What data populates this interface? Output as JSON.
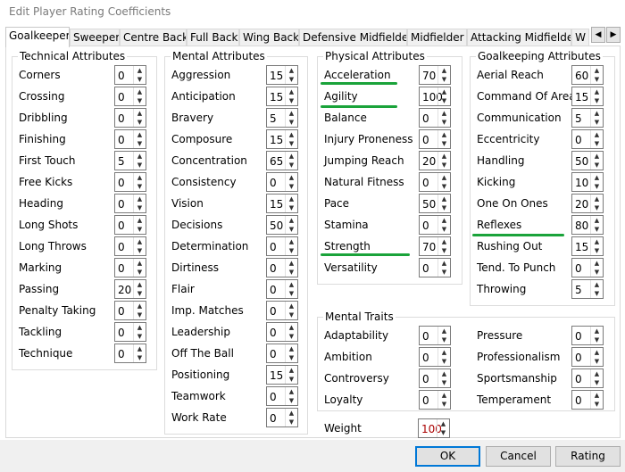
{
  "window": {
    "title": "Edit Player Rating Coefficients"
  },
  "tabs": [
    {
      "label": "Goalkeeper",
      "active": true
    },
    {
      "label": "Sweeper"
    },
    {
      "label": "Centre Back"
    },
    {
      "label": "Full Back"
    },
    {
      "label": "Wing Back"
    },
    {
      "label": "Defensive Midfielder"
    },
    {
      "label": "Midfielder"
    },
    {
      "label": "Attacking Midfielder"
    },
    {
      "label": "W"
    }
  ],
  "technical": {
    "title": "Technical Attributes",
    "items": [
      {
        "label": "Corners",
        "value": "0"
      },
      {
        "label": "Crossing",
        "value": "0"
      },
      {
        "label": "Dribbling",
        "value": "0"
      },
      {
        "label": "Finishing",
        "value": "0"
      },
      {
        "label": "First Touch",
        "value": "5"
      },
      {
        "label": "Free Kicks",
        "value": "0"
      },
      {
        "label": "Heading",
        "value": "0"
      },
      {
        "label": "Long Shots",
        "value": "0"
      },
      {
        "label": "Long Throws",
        "value": "0"
      },
      {
        "label": "Marking",
        "value": "0"
      },
      {
        "label": "Passing",
        "value": "20"
      },
      {
        "label": "Penalty Taking",
        "value": "0"
      },
      {
        "label": "Tackling",
        "value": "0"
      },
      {
        "label": "Technique",
        "value": "0"
      }
    ]
  },
  "mental": {
    "title": "Mental Attributes",
    "items": [
      {
        "label": "Aggression",
        "value": "15"
      },
      {
        "label": "Anticipation",
        "value": "15"
      },
      {
        "label": "Bravery",
        "value": "5"
      },
      {
        "label": "Composure",
        "value": "15"
      },
      {
        "label": "Concentration",
        "value": "65"
      },
      {
        "label": "Consistency",
        "value": "0"
      },
      {
        "label": "Vision",
        "value": "15"
      },
      {
        "label": "Decisions",
        "value": "50"
      },
      {
        "label": "Determination",
        "value": "0"
      },
      {
        "label": "Dirtiness",
        "value": "0"
      },
      {
        "label": "Flair",
        "value": "0"
      },
      {
        "label": "Imp. Matches",
        "value": "0"
      },
      {
        "label": "Leadership",
        "value": "0"
      },
      {
        "label": "Off The Ball",
        "value": "0"
      },
      {
        "label": "Positioning",
        "value": "15"
      },
      {
        "label": "Teamwork",
        "value": "0"
      },
      {
        "label": "Work Rate",
        "value": "0"
      }
    ]
  },
  "physical": {
    "title": "Physical Attributes",
    "items": [
      {
        "label": "Acceleration",
        "value": "70"
      },
      {
        "label": "Agility",
        "value": "100"
      },
      {
        "label": "Balance",
        "value": "0"
      },
      {
        "label": "Injury Proneness",
        "value": "0"
      },
      {
        "label": "Jumping Reach",
        "value": "20"
      },
      {
        "label": "Natural Fitness",
        "value": "0"
      },
      {
        "label": "Pace",
        "value": "50"
      },
      {
        "label": "Stamina",
        "value": "0"
      },
      {
        "label": "Strength",
        "value": "70"
      },
      {
        "label": "Versatility",
        "value": "0"
      }
    ]
  },
  "goalkeeping": {
    "title": "Goalkeeping Attributes",
    "items": [
      {
        "label": "Aerial Reach",
        "value": "60"
      },
      {
        "label": "Command Of Area",
        "value": "15"
      },
      {
        "label": "Communication",
        "value": "5"
      },
      {
        "label": "Eccentricity",
        "value": "0"
      },
      {
        "label": "Handling",
        "value": "50"
      },
      {
        "label": "Kicking",
        "value": "10"
      },
      {
        "label": "One On Ones",
        "value": "20"
      },
      {
        "label": "Reflexes",
        "value": "80"
      },
      {
        "label": "Rushing Out",
        "value": "15"
      },
      {
        "label": "Tend. To Punch",
        "value": "0"
      },
      {
        "label": "Throwing",
        "value": "5"
      }
    ]
  },
  "traits": {
    "title": "Mental Traits",
    "left": [
      {
        "label": "Adaptability",
        "value": "0"
      },
      {
        "label": "Ambition",
        "value": "0"
      },
      {
        "label": "Controversy",
        "value": "0"
      },
      {
        "label": "Loyalty",
        "value": "0"
      }
    ],
    "right": [
      {
        "label": "Pressure",
        "value": "0"
      },
      {
        "label": "Professionalism",
        "value": "0"
      },
      {
        "label": "Sportsmanship",
        "value": "0"
      },
      {
        "label": "Temperament",
        "value": "0"
      }
    ]
  },
  "weight": {
    "label": "Weight",
    "value": "100"
  },
  "buttons": {
    "ok": "OK",
    "cancel": "Cancel",
    "rating": "Rating"
  },
  "colors": {
    "highlight": "#1aa33a",
    "default_button_border": "#0078d7"
  }
}
